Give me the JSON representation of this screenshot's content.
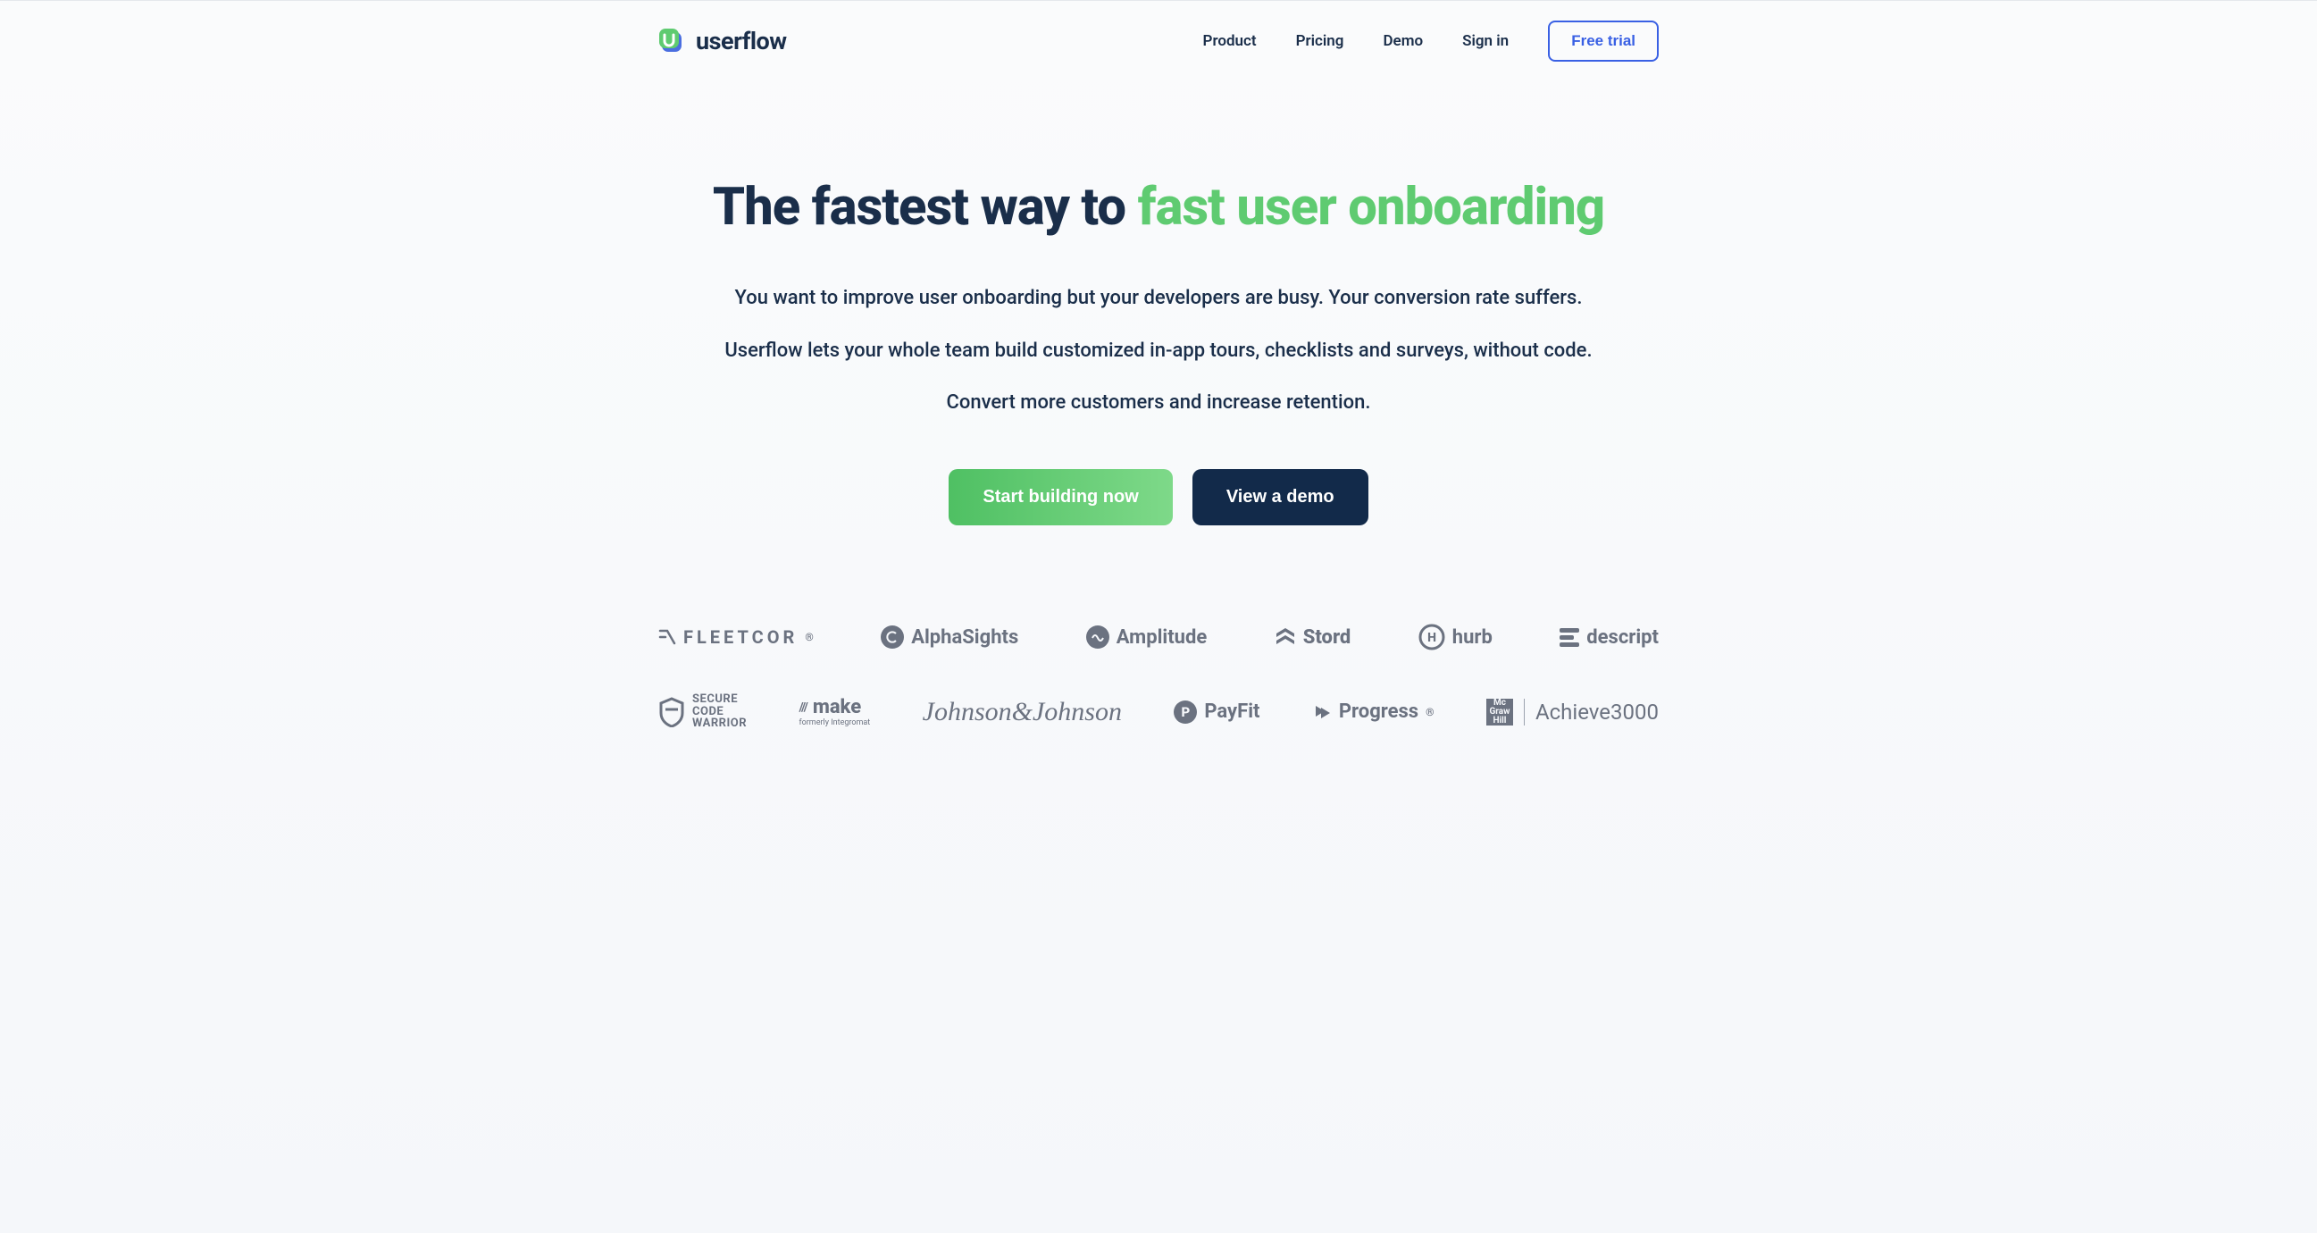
{
  "brand": {
    "name": "userflow"
  },
  "nav": {
    "links": [
      "Product",
      "Pricing",
      "Demo",
      "Sign in"
    ],
    "cta": "Free trial"
  },
  "hero": {
    "title_prefix": "The fastest way to ",
    "title_accent": "fast user onboarding",
    "sub1": "You want to improve user onboarding but your developers are busy. Your conversion rate suffers.",
    "sub2": "Userflow lets your whole team build customized in-app tours, checklists and surveys, without code.",
    "sub3": "Convert more customers and increase retention.",
    "cta_primary": "Start building now",
    "cta_secondary": "View a demo"
  },
  "clients": {
    "row1": [
      "FLEETCOR",
      "AlphaSights",
      "Amplitude",
      "Stord",
      "hurb",
      "descript"
    ],
    "row2_scw_l1": "SECURE",
    "row2_scw_l2": "CODE",
    "row2_scw_l3": "WARRIOR",
    "row2_make": "make",
    "row2_make_sub": "formerly Integromat",
    "row2_jnj": "Johnson&Johnson",
    "row2_payfit": "PayFit",
    "row2_progress": "Progress",
    "row2_mgh": "Mc Graw Hill",
    "row2_achieve": "Achieve3000"
  }
}
